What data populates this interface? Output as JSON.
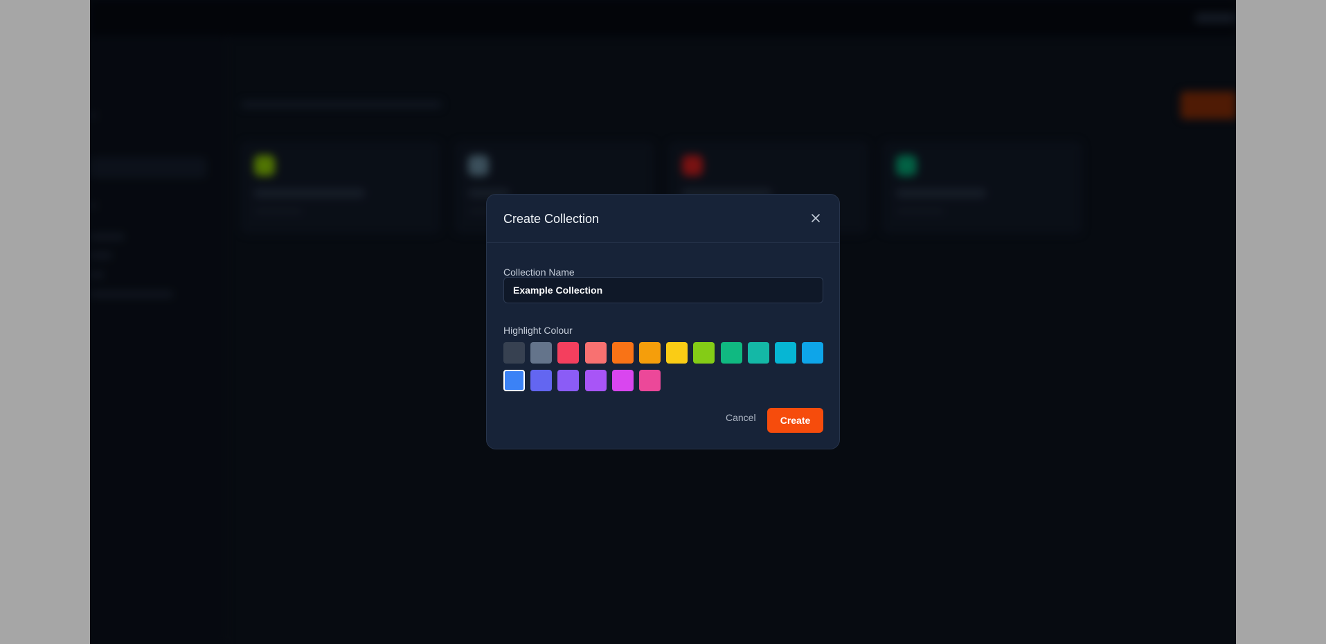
{
  "modal": {
    "title": "Create Collection",
    "name_label": "Collection Name",
    "name_value": "Example Collection",
    "colour_label": "Highlight Colour",
    "cancel_label": "Cancel",
    "create_label": "Create",
    "selected_colour": "#3b82f6",
    "swatches": [
      "#374151",
      "#64748b",
      "#f43f5e",
      "#f87171",
      "#f97316",
      "#f59e0b",
      "#facc15",
      "#84cc16",
      "#10b981",
      "#14b8a6",
      "#06b6d4",
      "#0ea5e9",
      "#3b82f6",
      "#6366f1",
      "#8b5cf6",
      "#a855f7",
      "#d946ef",
      "#ec4899"
    ],
    "close_icon": "close-icon"
  },
  "background": {
    "accent": "#f64c0c",
    "card_dots": [
      "#7cb305",
      "#5b7a8c",
      "#b91c1c",
      "#059669"
    ]
  }
}
